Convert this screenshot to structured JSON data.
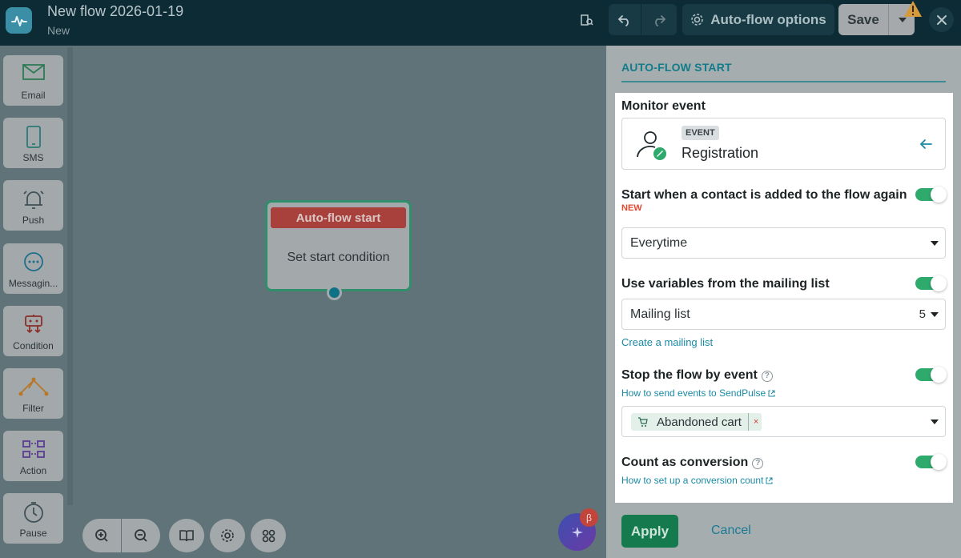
{
  "header": {
    "title": "New flow 2026-01-19",
    "status": "New",
    "options_label": "Auto-flow options",
    "save_label": "Save"
  },
  "sidebar": {
    "items": [
      {
        "label": "Email",
        "icon": "email-icon"
      },
      {
        "label": "SMS",
        "icon": "sms-icon"
      },
      {
        "label": "Push",
        "icon": "push-icon"
      },
      {
        "label": "Messagin...",
        "icon": "messaging-icon"
      },
      {
        "label": "Condition",
        "icon": "condition-icon"
      },
      {
        "label": "Filter",
        "icon": "filter-icon"
      },
      {
        "label": "Action",
        "icon": "action-icon"
      },
      {
        "label": "Pause",
        "icon": "pause-icon"
      }
    ]
  },
  "canvas": {
    "node_title": "Auto-flow start",
    "node_body": "Set start condition",
    "beta_badge": "β"
  },
  "panel": {
    "title": "AUTO-FLOW START",
    "monitor_label": "Monitor event",
    "event_tag": "EVENT",
    "event_name": "Registration",
    "restart_label": "Start when a contact is added to the flow again",
    "restart_badge": "NEW",
    "restart_value": "Everytime",
    "mailing_label": "Use variables from the mailing list",
    "mailing_placeholder": "Mailing list",
    "mailing_count": "5",
    "mailing_link": "Create a mailing list",
    "stop_label": "Stop the flow by event",
    "stop_help": "?",
    "stop_link": "How to send events to SendPulse",
    "stop_chip": "Abandoned cart",
    "chip_remove": "×",
    "conversion_label": "Count as conversion",
    "conversion_help": "?",
    "conversion_link": "How to set up a conversion count",
    "apply_label": "Apply",
    "cancel_label": "Cancel"
  },
  "colors": {
    "accent_green": "#2eaa6c",
    "node_header": "#a8413b",
    "link_blue": "#1b8aa6",
    "header_bg": "#0c2b35"
  }
}
